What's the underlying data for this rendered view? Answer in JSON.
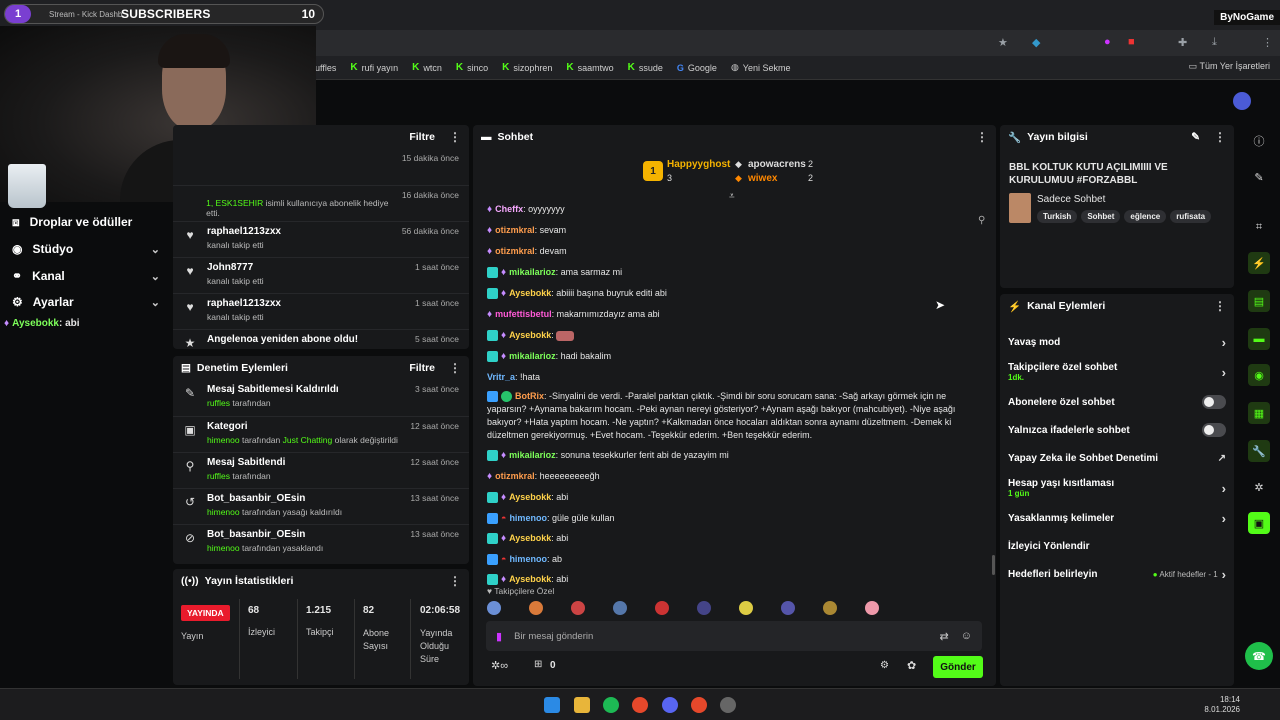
{
  "overlay": {
    "sub_count": "1",
    "stream_label": "Stream - Kick Dashb",
    "subscribers_label": "SUBSCRIBERS",
    "sub_goal": "10",
    "logo": "ByNoGame"
  },
  "bookmarks": {
    "items": [
      "ruffles",
      "rufi yayın",
      "wtcn",
      "sinco",
      "sizophren",
      "saamtwo",
      "ssude",
      "Google",
      "Yeni Sekme"
    ],
    "right": "Tüm Yer İşaretleri"
  },
  "nav": {
    "drops": "Droplar ve ödüller",
    "studio": "Stüdyo",
    "channel": "Kanal",
    "settings": "Ayarlar",
    "chat_user": "Aysebokk",
    "chat_text": ": abi"
  },
  "activity": {
    "filter": "Filtre",
    "items": [
      {
        "title": "",
        "sub": "",
        "time": "15 dakika önce"
      },
      {
        "title": "",
        "sub_num": "1, ESK1SEHIR",
        "sub": " isimli kullanıcıya abonelik hediye etti.",
        "time": "16 dakika önce"
      },
      {
        "title": "raphael1213zxx",
        "sub": "kanalı takip etti",
        "time": "56 dakika önce"
      },
      {
        "title": "John8777",
        "sub": "kanalı takip etti",
        "time": "1 saat önce"
      },
      {
        "title": "raphael1213zxx",
        "sub": "kanalı takip etti",
        "time": "1 saat önce"
      },
      {
        "title": "Angelenoa yeniden abone oldu!",
        "sub": "",
        "time": "5 saat önce"
      }
    ]
  },
  "moderation": {
    "title": "Denetim Eylemleri",
    "filter": "Filtre",
    "items": [
      {
        "title": "Mesaj Sabitlemesi Kaldırıldı",
        "user": "ruffles",
        "rest": " tarafından",
        "time": "3 saat önce"
      },
      {
        "title": "Kategori",
        "user": "himenoo",
        "rest": " tarafından ",
        "extra": "Just Chatting",
        "rest2": " olarak değiştirildi",
        "time": "12 saat önce"
      },
      {
        "title": "Mesaj Sabitlendi",
        "user": "ruffles",
        "rest": " tarafından",
        "time": "12 saat önce"
      },
      {
        "title": "Bot_basanbir_OEsin",
        "user": "himenoo",
        "rest": " tarafından yasağı kaldırıldı",
        "time": "13 saat önce"
      },
      {
        "title": "Bot_basanbir_OEsin",
        "user": "himenoo",
        "rest": " tarafından yasaklandı",
        "time": "13 saat önce"
      }
    ]
  },
  "stats": {
    "title": "Yayın İstatistikleri",
    "live": "YAYINDA",
    "live_label": "Yayın",
    "cols": [
      {
        "value": "68",
        "label": "İzleyici"
      },
      {
        "value": "1.215",
        "label": "Takipçi"
      },
      {
        "value": "82",
        "label": "Abone Sayısı"
      },
      {
        "value": "02:06:58",
        "label": "Yayında Olduğu Süre"
      }
    ]
  },
  "chat": {
    "title": "Sohbet",
    "leaders": {
      "first": "Happyyghost",
      "first_count": "3",
      "second": "apowacrens",
      "second_count": "2",
      "third": "wiwex",
      "third_count": "2",
      "rank": "1"
    },
    "messages": [
      {
        "user": "Cheffx",
        "text": ": oyyyyyyy",
        "color": "#f7a9ff"
      },
      {
        "user": "otizmkral",
        "text": ": sevam",
        "color": "#ff9d4d"
      },
      {
        "user": "otizmkral",
        "text": ": devam",
        "color": "#ff9d4d"
      },
      {
        "user": "mikailarioz",
        "text": ": ama sarmaz mi",
        "color": "#7dff5a"
      },
      {
        "user": "Aysebokk",
        "text": ": abiiii başına buyruk editi abi",
        "color": "#ffd24a"
      },
      {
        "user": "mufettisbetul",
        "text": ": makarnımızdayız ama abi",
        "color": "#ff5ad7"
      },
      {
        "user": "Aysebokk",
        "text": ": ",
        "color": "#ffd24a"
      },
      {
        "user": "mikailarioz",
        "text": ": hadi bakalim",
        "color": "#7dff5a"
      },
      {
        "user": "Vritr_a",
        "text": ": !hata",
        "color": "#6fb8ff"
      }
    ],
    "bot_user": "BotRix",
    "bot_text": ": -Sinyalini de verdi. -Paralel parktan çıktık. -Şimdi bir soru sorucam sana: -Sağ arkayı görmek için ne yaparsın? +Aynama bakarım hocam. -Peki aynan nereyi gösteriyor? +Aynam aşağı bakıyor (mahcubiyet). -Niye aşağı bakıyor? +Hata yaptım hocam. -Ne yaptın? +Kalkmadan önce hocaları aldıktan sonra aynamı düzeltmem. -Demek ki düzeltmen gerekiyormuş. +Evet hocam. -Teşekkür ederim. +Ben teşekkür ederim.",
    "messages2": [
      {
        "user": "mikailarioz",
        "text": ": sonuna tesekkurler ferit abi de yazayim mi",
        "color": "#7dff5a"
      },
      {
        "user": "otizmkral",
        "text": ": heeeeeeeeeğh",
        "color": "#ff9d4d"
      },
      {
        "user": "Aysebokk",
        "text": ": abi",
        "color": "#ffd24a"
      },
      {
        "user": "himenoo",
        "text": ": güle güle kullan",
        "color": "#6fb8ff"
      },
      {
        "user": "Aysebokk",
        "text": ": abi",
        "color": "#ffd24a"
      },
      {
        "user": "himenoo",
        "text": ": ab",
        "color": "#6fb8ff"
      },
      {
        "user": "Aysebokk",
        "text": ": abi",
        "color": "#ffd24a"
      }
    ],
    "followers_only": "Takipçilere Özel",
    "placeholder": "Bir mesaj gönderin",
    "points": "0",
    "send": "Gönder"
  },
  "stream_info": {
    "title": "Yayın bilgisi",
    "stream_title": "BBL KOLTUK KUTU AÇILIMIIII VE KURULUMUU #FORZABBL",
    "category": "Sadece Sohbet",
    "tags": [
      "Turkish",
      "Sohbet",
      "eğlence",
      "rufisata"
    ]
  },
  "channel_actions": {
    "title": "Kanal Eylemleri",
    "slow": "Yavaş mod",
    "followers": "Takipçilere özel sohbet",
    "followers_sub": "1dk.",
    "subs": "Abonelere özel sohbet",
    "emotes": "Yalnızca ifadelerle sohbet",
    "ai": "Yapay Zeka ile Sohbet Denetimi",
    "age": "Hesap yaşı kısıtlaması",
    "age_sub": "1 gün",
    "banned": "Yasaklanmış kelimeler",
    "redirect": "İzleyici Yönlendir",
    "goals": "Hedefleri belirleyin",
    "goals_status": "Aktif hedefler - 1"
  },
  "taskbar": {
    "time": "18:14",
    "date": "8.01.2026"
  }
}
